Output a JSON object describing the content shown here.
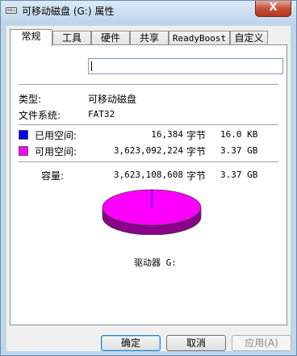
{
  "window": {
    "title": "可移动磁盘 (G:) 属性",
    "close_label": "X"
  },
  "tabs": [
    {
      "label": "常规",
      "active": true
    },
    {
      "label": "工具",
      "active": false
    },
    {
      "label": "硬件",
      "active": false
    },
    {
      "label": "共享",
      "active": false
    },
    {
      "label": "ReadyBoost",
      "active": false
    },
    {
      "label": "自定义",
      "active": false
    }
  ],
  "general": {
    "name_value": "",
    "type_label": "类型:",
    "type_value": "可移动磁盘",
    "fs_label": "文件系统:",
    "fs_value": "FAT32",
    "used": {
      "label": "已用空间:",
      "bytes": "16,384",
      "unit": "字节",
      "size": "16.0 KB",
      "color": "#0000ff"
    },
    "free": {
      "label": "可用空间:",
      "bytes": "3,623,092,224",
      "unit": "字节",
      "size": "3.37 GB",
      "color": "#ff00ff"
    },
    "capacity": {
      "label": "容量:",
      "bytes": "3,623,108,608",
      "unit": "字节",
      "size": "3.37 GB"
    },
    "drive_label": "驱动器 G:"
  },
  "buttons": {
    "ok": "确定",
    "cancel": "取消",
    "apply": "应用(A)"
  }
}
